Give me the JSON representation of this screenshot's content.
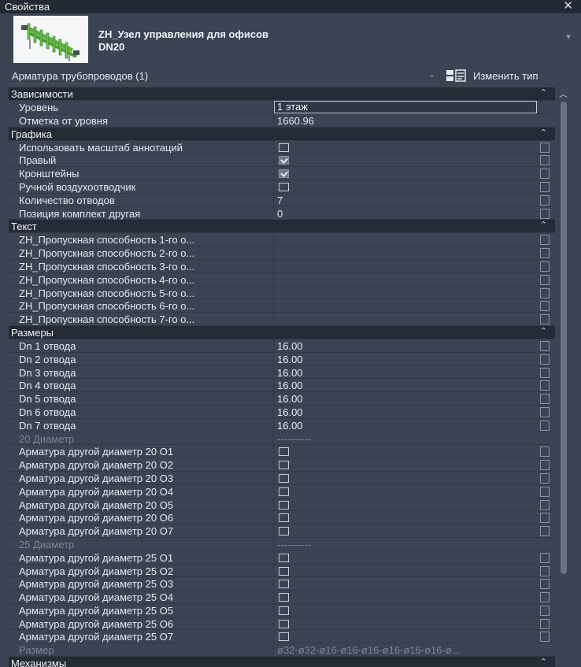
{
  "window": {
    "title": "Свойства"
  },
  "type_selector": {
    "name": "ZH_Узел управления для офисов",
    "dn": "DN20"
  },
  "instance_selector": {
    "label": "Арматура трубопроводов (1)",
    "edit_type_label": "Изменить тип"
  },
  "groups": [
    {
      "name": "Зависимости",
      "rows": [
        {
          "name": "Уровень",
          "kind": "input",
          "value": "1 этаж"
        },
        {
          "name": "Отметка от уровня",
          "kind": "text",
          "value": "1660.96"
        }
      ]
    },
    {
      "name": "Графика",
      "rows": [
        {
          "name": "Использовать масштаб аннотаций",
          "kind": "checkbox",
          "checked": false
        },
        {
          "name": "Правый",
          "kind": "checkbox",
          "checked": true
        },
        {
          "name": "Кронштейны",
          "kind": "checkbox",
          "checked": true
        },
        {
          "name": "Ручной воздухоотводчик",
          "kind": "checkbox",
          "checked": false
        },
        {
          "name": "Количество отводов",
          "kind": "text",
          "value": "7"
        },
        {
          "name": "Позиция комплект другая",
          "kind": "text",
          "value": "0"
        }
      ]
    },
    {
      "name": "Текст",
      "rows": [
        {
          "name": "ZH_Пропускная способность 1-го о...",
          "kind": "text",
          "value": ""
        },
        {
          "name": "ZH_Пропускная способность 2-го о...",
          "kind": "text",
          "value": ""
        },
        {
          "name": "ZH_Пропускная способность 3-го о...",
          "kind": "text",
          "value": ""
        },
        {
          "name": "ZH_Пропускная способность 4-го о...",
          "kind": "text",
          "value": ""
        },
        {
          "name": "ZH_Пропускная способность 5-го о...",
          "kind": "text",
          "value": ""
        },
        {
          "name": "ZH_Пропускная способность 6-го о...",
          "kind": "text",
          "value": ""
        },
        {
          "name": "ZH_Пропускная способность 7-го о...",
          "kind": "text",
          "value": ""
        }
      ]
    },
    {
      "name": "Размеры",
      "rows": [
        {
          "name": "Dn 1 отвода",
          "kind": "text",
          "value": "16.00"
        },
        {
          "name": "Dn 2 отвода",
          "kind": "text",
          "value": "16.00"
        },
        {
          "name": "Dn 3 отвода",
          "kind": "text",
          "value": "16.00"
        },
        {
          "name": "Dn 4 отвода",
          "kind": "text",
          "value": "16.00"
        },
        {
          "name": "Dn 5 отвода",
          "kind": "text",
          "value": "16.00"
        },
        {
          "name": "Dn 6 отвода",
          "kind": "text",
          "value": "16.00"
        },
        {
          "name": "Dn 7 отвода",
          "kind": "text",
          "value": "16.00"
        },
        {
          "name": "20 Диаметр",
          "kind": "dim",
          "value": "----------"
        },
        {
          "name": "Арматура другой диаметр 20 О1",
          "kind": "checkbox",
          "checked": false
        },
        {
          "name": "Арматура другой диаметр 20 О2",
          "kind": "checkbox",
          "checked": false
        },
        {
          "name": "Арматура другой диаметр 20 О3",
          "kind": "checkbox",
          "checked": false
        },
        {
          "name": "Арматура другой диаметр 20 О4",
          "kind": "checkbox",
          "checked": false
        },
        {
          "name": "Арматура другой диаметр 20 О5",
          "kind": "checkbox",
          "checked": false
        },
        {
          "name": "Арматура другой диаметр 20 О6",
          "kind": "checkbox",
          "checked": false
        },
        {
          "name": "Арматура другой диаметр 20 О7",
          "kind": "checkbox",
          "checked": false
        },
        {
          "name": "25 Диаметр",
          "kind": "dim",
          "value": "----------"
        },
        {
          "name": "Арматура другой диаметр 25 О1",
          "kind": "checkbox",
          "checked": false
        },
        {
          "name": "Арматура другой диаметр 25 О2",
          "kind": "checkbox",
          "checked": false
        },
        {
          "name": "Арматура другой диаметр 25 О3",
          "kind": "checkbox",
          "checked": false
        },
        {
          "name": "Арматура другой диаметр 25 О4",
          "kind": "checkbox",
          "checked": false
        },
        {
          "name": "Арматура другой диаметр 25 О5",
          "kind": "checkbox",
          "checked": false
        },
        {
          "name": "Арматура другой диаметр 25 О6",
          "kind": "checkbox",
          "checked": false
        },
        {
          "name": "Арматура другой диаметр 25 О7",
          "kind": "checkbox",
          "checked": false
        },
        {
          "name": "Размер",
          "kind": "dim",
          "value": "ø32-ø32-ø16-ø16-ø16-ø16-ø16-ø16-ø..."
        }
      ]
    },
    {
      "name": "Механизмы",
      "rows": []
    }
  ],
  "colors": {
    "panel_bg": "#3b4453",
    "group_bg": "#242b35",
    "title_bg": "#242a33"
  }
}
